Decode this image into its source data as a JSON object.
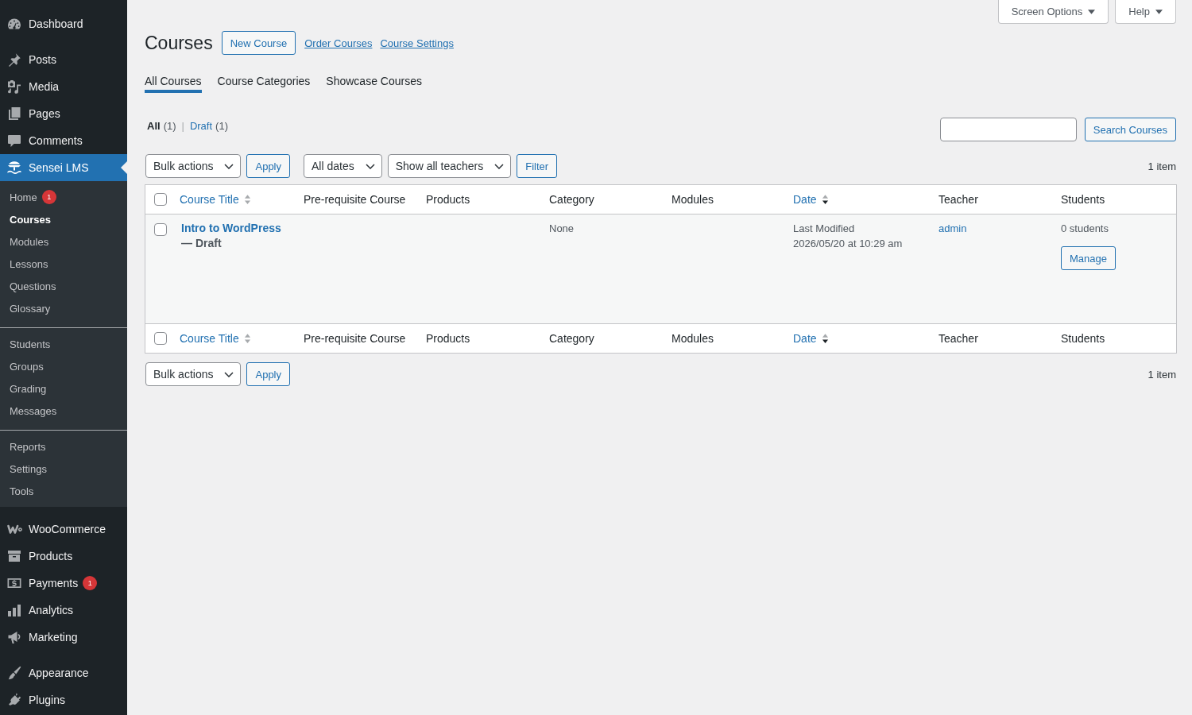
{
  "sidebar": {
    "groups": [
      [
        {
          "label": "Dashboard",
          "selected": false
        }
      ],
      [
        {
          "label": "Posts",
          "selected": false
        },
        {
          "label": "Media",
          "selected": false
        },
        {
          "label": "Pages",
          "selected": false
        },
        {
          "label": "Comments",
          "selected": false
        },
        {
          "label": "Sensei LMS",
          "selected": true,
          "submenu": [
            [
              {
                "label": "Home",
                "selected": false,
                "badge": "1"
              },
              {
                "label": "Courses",
                "selected": true
              },
              {
                "label": "Modules",
                "selected": false
              },
              {
                "label": "Lessons",
                "selected": false
              },
              {
                "label": "Questions",
                "selected": false
              },
              {
                "label": "Glossary",
                "selected": false
              }
            ],
            [
              {
                "label": "Students",
                "selected": false
              },
              {
                "label": "Groups",
                "selected": false
              },
              {
                "label": "Grading",
                "selected": false
              },
              {
                "label": "Messages",
                "selected": false
              }
            ],
            [
              {
                "label": "Reports",
                "selected": false
              },
              {
                "label": "Settings",
                "selected": false
              },
              {
                "label": "Tools",
                "selected": false
              }
            ]
          ]
        }
      ],
      [
        {
          "label": "WooCommerce",
          "selected": false
        },
        {
          "label": "Products",
          "selected": false
        },
        {
          "label": "Payments",
          "selected": false,
          "badge": "1"
        },
        {
          "label": "Analytics",
          "selected": false
        },
        {
          "label": "Marketing",
          "selected": false
        }
      ],
      [
        {
          "label": "Appearance",
          "selected": false
        },
        {
          "label": "Plugins",
          "selected": false
        }
      ]
    ]
  },
  "screen_meta": [
    "Screen Options",
    "Help"
  ],
  "header": {
    "title": "Courses",
    "actions": [
      {
        "kind": "button",
        "label": "New Course"
      },
      {
        "kind": "link",
        "label": "Order Courses"
      },
      {
        "kind": "link",
        "label": "Course Settings"
      }
    ]
  },
  "tabs": [
    {
      "label": "All Courses",
      "selected": true
    },
    {
      "label": "Course Categories",
      "selected": false
    },
    {
      "label": "Showcase Courses",
      "selected": false
    }
  ],
  "views": {
    "separator": "|",
    "items": [
      {
        "label": "All",
        "count": "(1)",
        "selected": true
      },
      {
        "label": "Draft",
        "count": "(1)",
        "selected": false
      }
    ]
  },
  "search": {
    "button": "Search Courses"
  },
  "tablenav_top": {
    "groups": [
      [
        {
          "kind": "select",
          "value": "Bulk actions"
        },
        {
          "kind": "button",
          "label": "Apply"
        }
      ],
      [
        {
          "kind": "select",
          "value": "All dates"
        },
        {
          "kind": "select",
          "value": "Show all teachers"
        },
        {
          "kind": "button",
          "label": "Filter"
        }
      ]
    ],
    "count": "1 item"
  },
  "table": {
    "columns": [
      {
        "kind": "checkbox",
        "checked": false
      },
      {
        "kind": "sortable",
        "label": "Course Title",
        "sorted": false
      },
      {
        "kind": "text",
        "label": "Pre-requisite Course"
      },
      {
        "kind": "text",
        "label": "Products"
      },
      {
        "kind": "text",
        "label": "Category"
      },
      {
        "kind": "text",
        "label": "Modules"
      },
      {
        "kind": "sortable",
        "label": "Date",
        "sorted": true,
        "descending": true
      },
      {
        "kind": "text",
        "label": "Teacher"
      },
      {
        "kind": "text",
        "label": "Students"
      }
    ],
    "rows": [
      {
        "checked": false,
        "title": "Intro to WordPress",
        "post_state": "— Draft",
        "category": "None",
        "date_label": "Last Modified",
        "date": "2026/05/20 at 10:29 am",
        "teacher": "admin",
        "students": "0 students",
        "action": "Manage"
      }
    ],
    "footer_columns": [
      {
        "kind": "checkbox",
        "checked": false
      },
      {
        "kind": "sortable",
        "label": "Course Title",
        "sorted": false
      },
      {
        "kind": "text",
        "label": "Pre-requisite Course"
      },
      {
        "kind": "text",
        "label": "Products"
      },
      {
        "kind": "text",
        "label": "Category"
      },
      {
        "kind": "text",
        "label": "Modules"
      },
      {
        "kind": "sortable",
        "label": "Date",
        "sorted": true,
        "descending": true
      },
      {
        "kind": "text",
        "label": "Teacher"
      },
      {
        "kind": "text",
        "label": "Students"
      }
    ]
  },
  "tablenav_bottom": {
    "groups": [
      [
        {
          "kind": "select",
          "value": "Bulk actions"
        },
        {
          "kind": "button",
          "label": "Apply"
        }
      ]
    ],
    "count": "1 item"
  }
}
